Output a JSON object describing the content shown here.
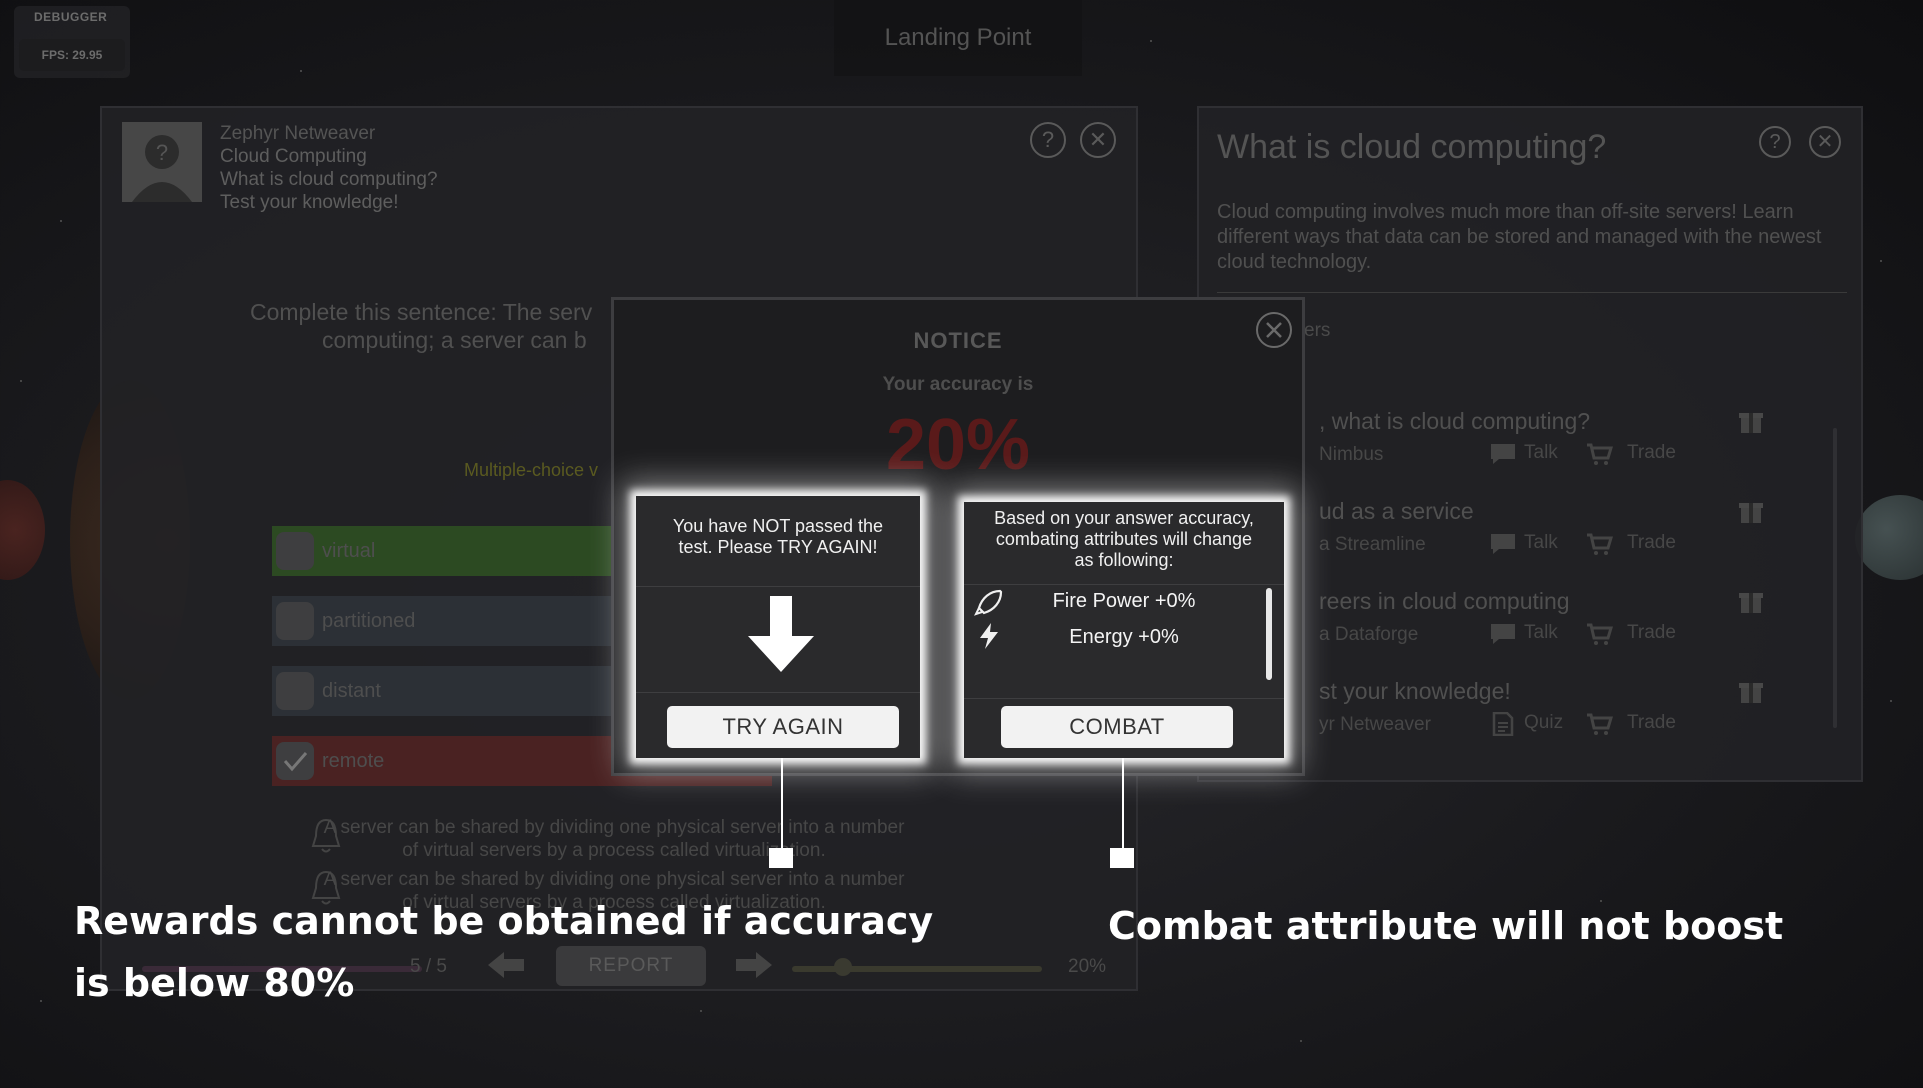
{
  "debugger": {
    "title": "DEBUGGER",
    "fps": "FPS: 29.95"
  },
  "location": "Landing Point",
  "npc": {
    "name": "Zephyr Netweaver",
    "lines": [
      "Cloud Computing",
      "What is cloud computing?",
      "Test your knowledge!"
    ]
  },
  "quiz": {
    "question_line1": "Complete this sentence: The serv",
    "question_line2": "computing; a server can b",
    "type_label": "Multiple-choice v",
    "answers": [
      {
        "label": "virtual",
        "checked": false,
        "color": "#2c4a22"
      },
      {
        "label": "partitioned",
        "checked": false,
        "color": "#2c3036"
      },
      {
        "label": "distant",
        "checked": false,
        "color": "#2c3036"
      },
      {
        "label": "remote",
        "checked": true,
        "color": "#4a2222"
      }
    ],
    "hints": [
      "A server can be shared by dividing one physical server into a number of virtual servers by a process called virtualization.",
      "A server can be shared by dividing one physical server into a number of virtual servers by a process called virtualization."
    ],
    "page": "5 / 5",
    "report_label": "REPORT",
    "slider_value": "20%"
  },
  "right_panel": {
    "title": "What is cloud computing?",
    "description": "Cloud computing involves much more than off-site servers! Learn different ways that data can be stored and managed with the newest cloud technology.",
    "tab_fragment": "ers",
    "quests": [
      {
        "title": ", what is cloud computing?",
        "npc": "Nimbus",
        "action1": "Talk",
        "action2": "Trade"
      },
      {
        "title": "ud as a service",
        "npc": "a Streamline",
        "action1": "Talk",
        "action2": "Trade"
      },
      {
        "title": "reers in cloud computing",
        "npc": "a Dataforge",
        "action1": "Talk",
        "action2": "Trade"
      },
      {
        "title": "st your knowledge!",
        "npc": "yr Netweaver",
        "action1": "Quiz",
        "action2": "Trade"
      }
    ]
  },
  "notice": {
    "title": "NOTICE",
    "accuracy_label": "Your accuracy is",
    "accuracy_value": "20%",
    "fail_message": "You have NOT passed the test. Please TRY AGAIN!",
    "try_again_label": "TRY AGAIN",
    "attr_message": "Based on your answer accuracy, combating attributes will change as following:",
    "attributes": [
      {
        "label": "Fire Power +0%",
        "icon": "rocket-icon"
      },
      {
        "label": "Energy +0%",
        "icon": "lightning-icon"
      }
    ],
    "combat_label": "COMBAT"
  },
  "captions": {
    "left_line1": "Rewards cannot be obtained if accuracy",
    "left_line2": "is below 80%",
    "right": "Combat attribute will not boost"
  }
}
